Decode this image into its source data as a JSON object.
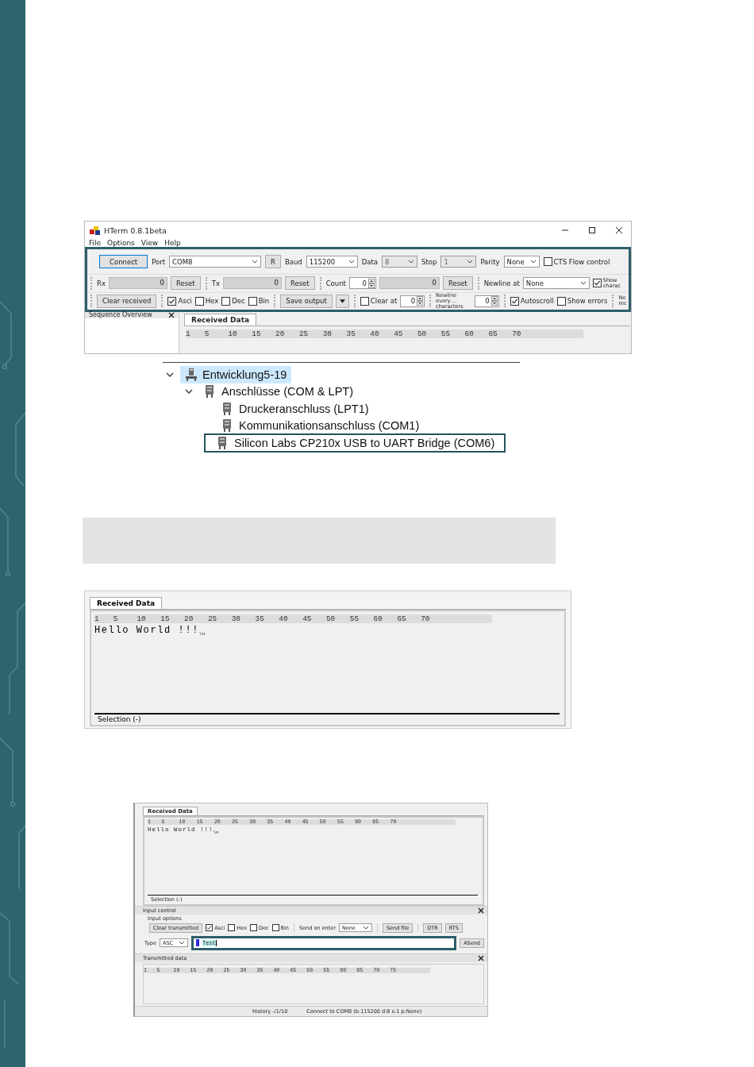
{
  "hterm_window": {
    "title": "HTerm 0.8.1beta",
    "menu": [
      "File",
      "Options",
      "View",
      "Help"
    ],
    "toolbar_rows": [
      [
        {
          "kind": "button",
          "label": "Connect",
          "default": true
        },
        {
          "kind": "label",
          "text": "Port"
        },
        {
          "kind": "combo",
          "value": "COM8",
          "disabled": false
        },
        {
          "kind": "button",
          "label": "R",
          "default": false
        },
        {
          "kind": "label",
          "text": "Baud"
        },
        {
          "kind": "combo",
          "value": "115200",
          "disabled": false
        },
        {
          "kind": "label",
          "text": "Data"
        },
        {
          "kind": "combo",
          "value": "8",
          "disabled": true
        },
        {
          "kind": "label",
          "text": "Stop"
        },
        {
          "kind": "combo",
          "value": "1",
          "disabled": true
        },
        {
          "kind": "label",
          "text": "Parity"
        },
        {
          "kind": "combo",
          "value": "None",
          "disabled": false
        },
        {
          "kind": "check",
          "label": "CTS Flow control",
          "checked": false
        }
      ],
      [
        {
          "kind": "grip"
        },
        {
          "kind": "label",
          "text": "Rx"
        },
        {
          "kind": "field",
          "value": "0"
        },
        {
          "kind": "button",
          "label": "Reset",
          "default": false
        },
        {
          "kind": "grip"
        },
        {
          "kind": "label",
          "text": "Tx"
        },
        {
          "kind": "field",
          "value": "0"
        },
        {
          "kind": "button",
          "label": "Reset",
          "default": false
        },
        {
          "kind": "grip"
        },
        {
          "kind": "label",
          "text": "Count"
        },
        {
          "kind": "spin",
          "value": "0"
        },
        {
          "kind": "field",
          "value": "0"
        },
        {
          "kind": "button",
          "label": "Reset",
          "default": false
        },
        {
          "kind": "grip"
        },
        {
          "kind": "label",
          "text": "Newline at"
        },
        {
          "kind": "combo",
          "value": "None",
          "disabled": false
        },
        {
          "kind": "check",
          "label": "Show charac",
          "checked": true
        }
      ],
      [
        {
          "kind": "grip"
        },
        {
          "kind": "button",
          "label": "Clear received",
          "default": false
        },
        {
          "kind": "grip"
        },
        {
          "kind": "check",
          "label": "Asci",
          "checked": true
        },
        {
          "kind": "check",
          "label": "Hex",
          "checked": false
        },
        {
          "kind": "check",
          "label": "Dec",
          "checked": false
        },
        {
          "kind": "check",
          "label": "Bin",
          "checked": false
        },
        {
          "kind": "grip"
        },
        {
          "kind": "button",
          "label": "Save output",
          "default": false
        },
        {
          "kind": "dropbutton"
        },
        {
          "kind": "grip"
        },
        {
          "kind": "check",
          "label": "Clear at",
          "checked": false
        },
        {
          "kind": "spin",
          "value": "0"
        },
        {
          "kind": "grip"
        },
        {
          "kind": "label",
          "text": "Newline every ... characters"
        },
        {
          "kind": "spin",
          "value": "0"
        },
        {
          "kind": "grip"
        },
        {
          "kind": "check",
          "label": "Autoscroll",
          "checked": true
        },
        {
          "kind": "check",
          "label": "Show errors",
          "checked": false
        },
        {
          "kind": "grip"
        },
        {
          "kind": "label",
          "text": "Ne rec"
        }
      ]
    ],
    "sidebar": {
      "title": "Sequence Overview"
    },
    "tab": {
      "label": "Received Data",
      "selected": true
    },
    "ruler": [
      "1",
      "5",
      "10",
      "15",
      "20",
      "25",
      "30",
      "35",
      "40",
      "45",
      "50",
      "55",
      "60",
      "65",
      "70"
    ]
  },
  "device_tree": {
    "items": [
      {
        "label": "Entwicklung5-19",
        "kind": "computer",
        "expanded": true,
        "selected": true,
        "outlined": false,
        "children": [
          {
            "label": "Anschlüsse (COM & LPT)",
            "kind": "port",
            "expanded": true,
            "selected": false,
            "outlined": false,
            "children": [
              {
                "label": "Druckeranschluss (LPT1)",
                "kind": "port",
                "selected": false,
                "outlined": false
              },
              {
                "label": "Kommunikationsanschluss (COM1)",
                "kind": "port",
                "selected": false,
                "outlined": false
              },
              {
                "label": "Silicon Labs CP210x USB to UART Bridge (COM6)",
                "kind": "port",
                "selected": false,
                "outlined": true
              }
            ]
          }
        ]
      }
    ]
  },
  "received_panel": {
    "tab": {
      "label": "Received Data",
      "selected": true
    },
    "ruler": [
      "1",
      "5",
      "10",
      "15",
      "20",
      "25",
      "30",
      "35",
      "40",
      "45",
      "50",
      "55",
      "60",
      "65",
      "70"
    ],
    "lines": [
      "Hello World !!!$_{\\n}$"
    ],
    "status": "Selection (-)"
  },
  "input_window": {
    "tab": {
      "label": "Received Data",
      "selected": true
    },
    "ruler": [
      "1",
      "5",
      "10",
      "15",
      "20",
      "25",
      "30",
      "35",
      "40",
      "45",
      "50",
      "55",
      "60",
      "65",
      "70"
    ],
    "lines": [
      "Hello World !!!$_{\\n}$"
    ],
    "status": "Selection (-)",
    "input_control": {
      "title": "Input control",
      "options_label": "Input options",
      "options_row": [
        {
          "kind": "button",
          "label": "Clear transmitted",
          "default": false
        },
        {
          "kind": "check",
          "label": "Asci",
          "checked": true
        },
        {
          "kind": "check",
          "label": "Hex",
          "checked": false
        },
        {
          "kind": "check",
          "label": "Dec",
          "checked": false
        },
        {
          "kind": "check",
          "label": "Bin",
          "checked": false
        },
        {
          "kind": "grip"
        },
        {
          "kind": "label",
          "text": "Send on enter"
        },
        {
          "kind": "combo",
          "value": "None",
          "disabled": false
        },
        {
          "kind": "grip"
        },
        {
          "kind": "button",
          "label": "Send file",
          "default": false
        },
        {
          "kind": "grip"
        },
        {
          "kind": "button",
          "label": "DTR",
          "default": false
        },
        {
          "kind": "button",
          "label": "RTS",
          "default": false
        }
      ],
      "type_label": "Type",
      "type_value": "ASC",
      "input_value": "Test",
      "send_label": "ASend"
    },
    "transmitted": {
      "title": "Transmitted data",
      "ruler": [
        "1",
        "5",
        "10",
        "15",
        "20",
        "25",
        "30",
        "35",
        "40",
        "45",
        "50",
        "55",
        "60",
        "65",
        "70",
        "75"
      ]
    },
    "status_bar": [
      "History -/1/10",
      "Connect to COM8 (b:115200 d:8 s:1 p:None)"
    ]
  }
}
